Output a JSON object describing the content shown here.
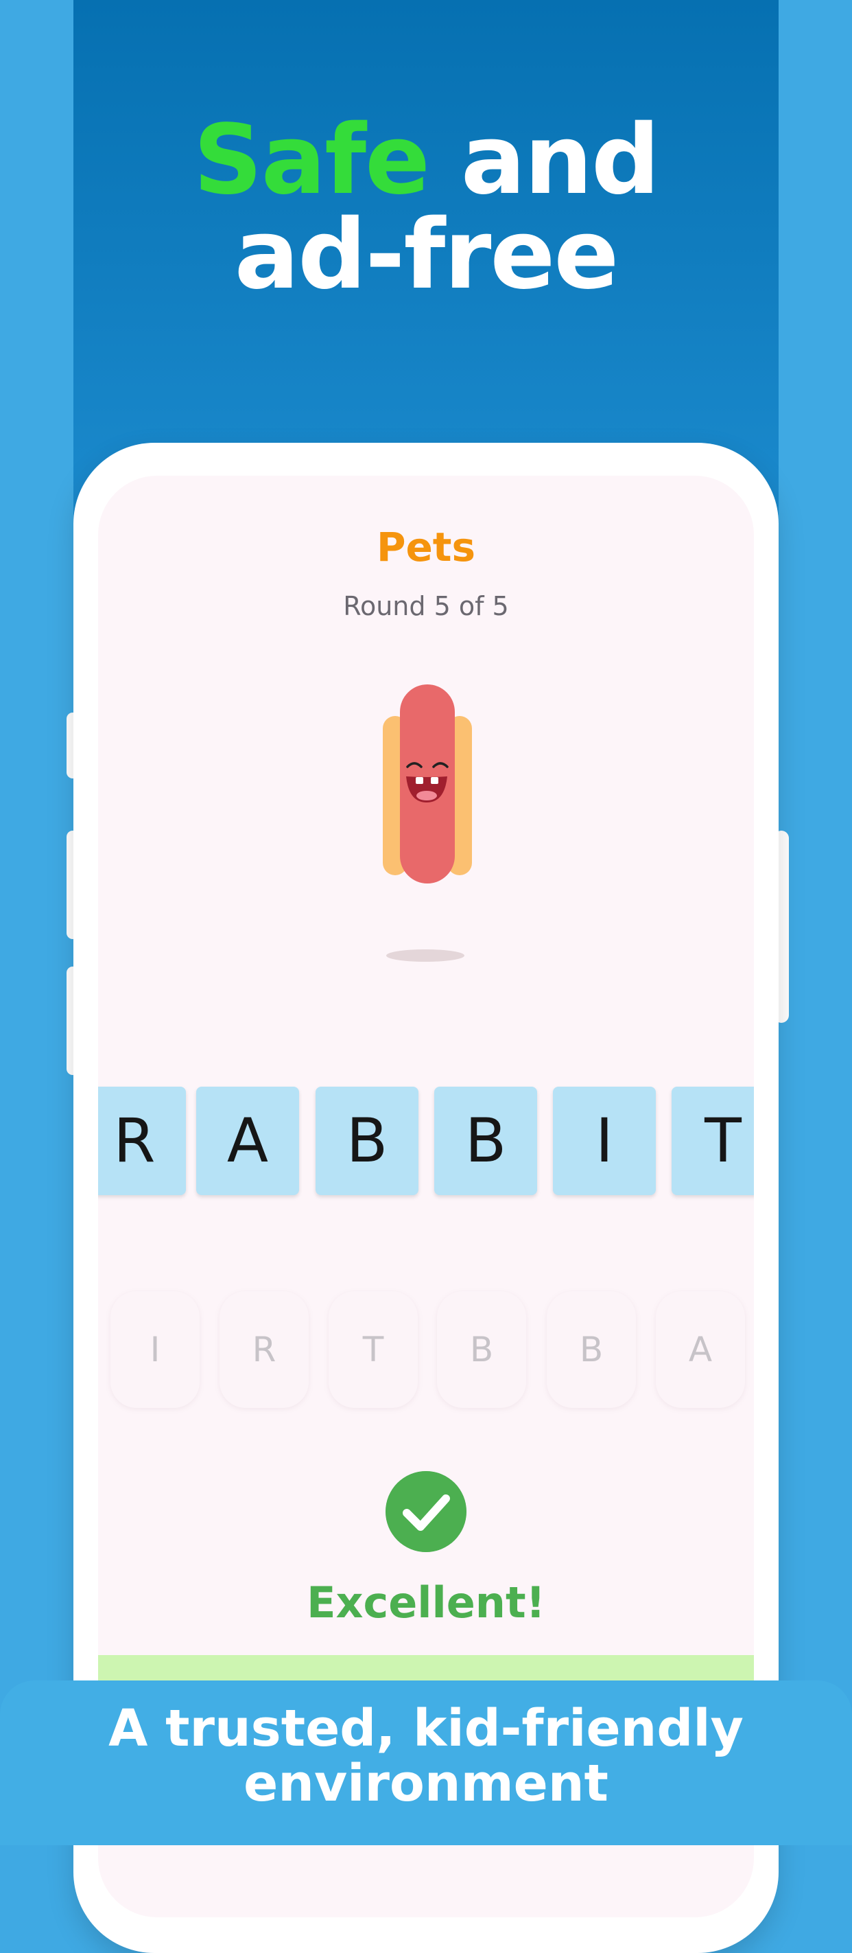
{
  "headline": {
    "accent_word": "Safe",
    "rest_line1": " and",
    "line2": "ad-free"
  },
  "game": {
    "category": "Pets",
    "round_text": "Round 5 of 5",
    "answer_letters": [
      "R",
      "A",
      "B",
      "B",
      "I",
      "T"
    ],
    "choice_letters": [
      "I",
      "R",
      "T",
      "B",
      "B",
      "A"
    ],
    "feedback": "Excellent!"
  },
  "caption": {
    "line1": "A trusted, kid-friendly",
    "line2": "environment"
  },
  "icons": {
    "mascot": "hotdog-mascot-icon",
    "success": "checkmark-icon"
  },
  "colors": {
    "accent_green": "#34dc3a",
    "category_orange": "#f5940e",
    "success_green": "#4caf50",
    "tile_blue": "#b6e2f6"
  }
}
